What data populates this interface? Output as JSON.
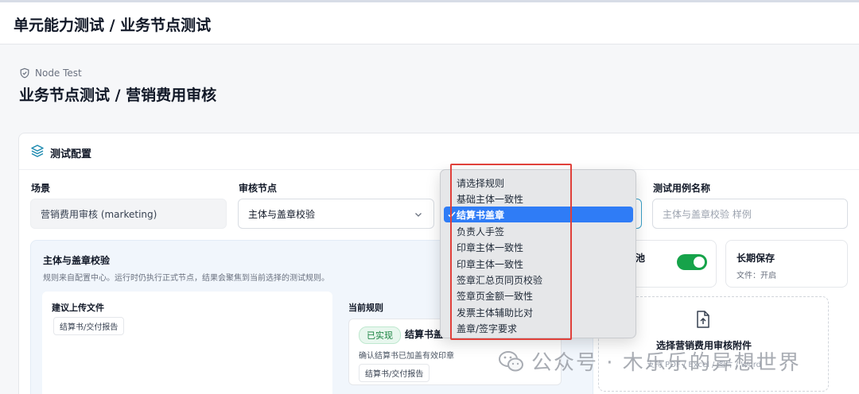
{
  "app": {
    "title": "单元能力测试 / 业务节点测试"
  },
  "page": {
    "crumb": "Node Test",
    "title": "业务节点测试 / 营销费用审核"
  },
  "card": {
    "title": "测试配置"
  },
  "fields": {
    "scene_label": "场景",
    "scene_value": "营销费用审核 (marketing)",
    "node_label": "审核节点",
    "node_value": "主体与盖章校验",
    "case_label": "测试用例名称",
    "case_placeholder": "主体与盖章校验 样例"
  },
  "rule_panel": {
    "title": "主体与盖章校验",
    "desc": "规则来自配置中心。运行时仍执行正式节点，结果会聚焦到当前选择的测试规则。",
    "upload_label": "建议上传文件",
    "upload_tag": "结算书/交付报告",
    "current_label": "当前规则",
    "badge": "已实现",
    "rule_name": "结算书盖",
    "rule_desc": "确认结算书已加盖有效印章",
    "rule_tag": "结算书/交付报告"
  },
  "options": {
    "pool_title": "池",
    "long_title": "长期保存",
    "long_sub": "文件：开启",
    "toggle_on": true
  },
  "upload": {
    "title": "选择营销费用审核附件",
    "sub": "支持 PDF / Excel / 图片 / Word"
  },
  "dropdown": {
    "items": [
      "请选择规则",
      "基础主体一致性",
      "结算书盖章",
      "负责人手签",
      "印章主体一致性",
      "印章主体一致性",
      "签章汇总页同页校验",
      "签章页金额一致性",
      "发票主体辅助比对",
      "盖章/签字要求"
    ],
    "selected": "结算书盖章"
  },
  "watermark": {
    "text": "公众号 · 木乐乐的异想世界"
  },
  "colors": {
    "accent": "#2f7cf6",
    "toggle": "#16a34a",
    "highlight": "#e0403a"
  },
  "icons": [
    "shield-icon",
    "layers-icon",
    "chevron-down-icon",
    "check-icon",
    "file-upload-icon",
    "wechat-icon"
  ]
}
